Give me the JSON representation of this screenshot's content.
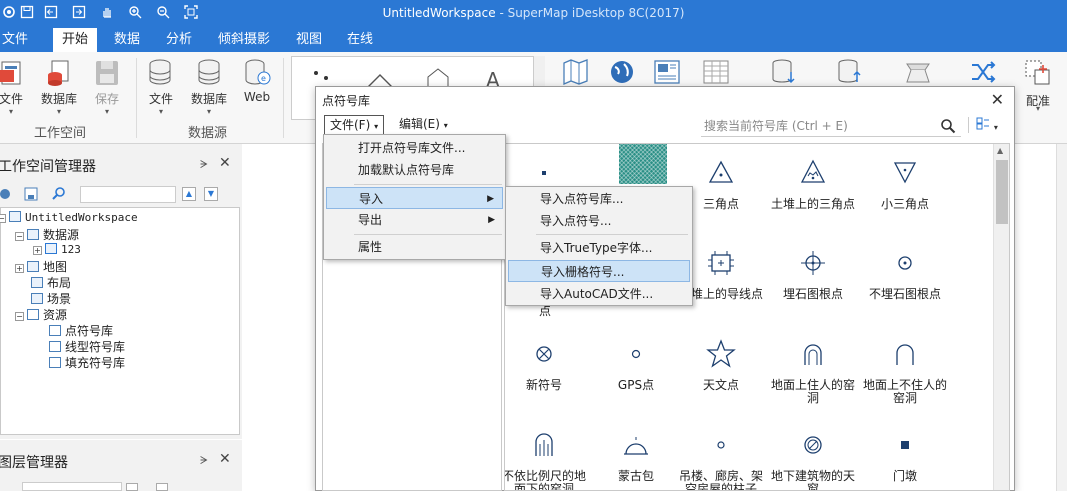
{
  "window": {
    "title": "UntitledWorkspace - SuperMap iDesktop 8C(2017)",
    "title_ws": "UntitledWorkspace",
    "title_app": " - SuperMap iDesktop 8C(2017)"
  },
  "quick_access": [
    "app-icon",
    "save-icon",
    "undo-icon",
    "redo-icon",
    "pan-icon",
    "zoom-in-icon",
    "zoom-out-icon",
    "full-extent-icon"
  ],
  "tabs": [
    "文件",
    "开始",
    "数据",
    "分析",
    "倾斜摄影",
    "视图",
    "在线"
  ],
  "active_tab": "开始",
  "ribbon": {
    "workspace": {
      "label": "工作空间",
      "buttons": [
        "文件",
        "数据库",
        "保存"
      ]
    },
    "datasource": {
      "label": "数据源",
      "buttons": [
        "文件",
        "数据库",
        "Web"
      ]
    },
    "right_label": "配准"
  },
  "workspace_manager": {
    "title": "工作空间管理器",
    "tree": {
      "root": "UntitledWorkspace",
      "datasources": "数据源",
      "ds_item": "123",
      "maps": "地图",
      "layouts": "布局",
      "scenes": "场景",
      "resources": "资源",
      "point_lib": "点符号库",
      "line_lib": "线型符号库",
      "fill_lib": "填充符号库"
    }
  },
  "layer_manager": {
    "title": "图层管理器"
  },
  "dialog": {
    "title": "点符号库",
    "menu_file": "文件(F)",
    "menu_edit": "编辑(E)",
    "search_placeholder": "搜索当前符号库 (Ctrl + E)",
    "file_menu": {
      "open": "打开点符号库文件...",
      "load_default": "加载默认点符号库",
      "import": "导入",
      "export": "导出",
      "properties": "属性"
    },
    "import_menu": {
      "import_lib": "导入点符号库...",
      "import_symbol": "导入点符号...",
      "import_truetype": "导入TrueType字体...",
      "import_raster": "导入栅格符号...",
      "import_autocad": "导入AutoCAD文件..."
    },
    "symbols": [
      {
        "label": "",
        "icon": "dot"
      },
      {
        "label": "",
        "icon": "hatched-square"
      },
      {
        "label": "三角点",
        "icon": "triangle-dot"
      },
      {
        "label": "土堆上的三角点",
        "icon": "mound-triangle"
      },
      {
        "label": "小三角点",
        "icon": "inverted-triangle"
      },
      {
        "label": "点",
        "icon": "hidden"
      },
      {
        "label": "",
        "icon": "hidden"
      },
      {
        "label": "土堆上的导线点",
        "icon": "mound-traverse"
      },
      {
        "label": "埋石图根点",
        "icon": "buried-stone"
      },
      {
        "label": "不埋石图根点",
        "icon": "unburied-stone"
      },
      {
        "label": "新符号",
        "icon": "circle-x"
      },
      {
        "label": "GPS点",
        "icon": "small-circle"
      },
      {
        "label": "天文点",
        "icon": "star"
      },
      {
        "label": "地面上住人的窑洞",
        "icon": "arch-inhabited"
      },
      {
        "label": "地面上不住人的窑洞",
        "icon": "arch-uninhabited"
      },
      {
        "label": "不依比例尺的地面下的窑洞",
        "icon": "underground-arch"
      },
      {
        "label": "蒙古包",
        "icon": "yurt"
      },
      {
        "label": "吊楼、廊房、架空房屋的柱子",
        "icon": "pillar"
      },
      {
        "label": "地下建筑物的天窗",
        "icon": "skylight"
      },
      {
        "label": "门墩",
        "icon": "square"
      }
    ]
  }
}
